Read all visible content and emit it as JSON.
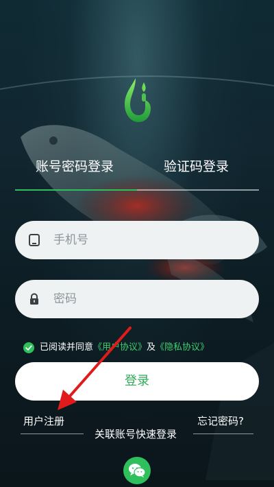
{
  "tabs": {
    "account_password": "账号密码登录",
    "verification_code": "验证码登录"
  },
  "form": {
    "phone_placeholder": "手机号",
    "password_placeholder": "密码"
  },
  "agreement": {
    "prefix": "已阅读并同意",
    "user_agreement": "《用户协议》",
    "and": "及",
    "privacy_agreement": "《隐私协议》",
    "checked": true
  },
  "login_button": "登录",
  "links": {
    "register": "用户注册",
    "forgot_password": "忘记密码?"
  },
  "quick_login": {
    "label": "关联账号快速登录",
    "providers": [
      "wechat-icon"
    ]
  },
  "colors": {
    "accent": "#2fbf5c",
    "link": "#3ccf6e",
    "annotation_arrow": "#e01b1b"
  }
}
